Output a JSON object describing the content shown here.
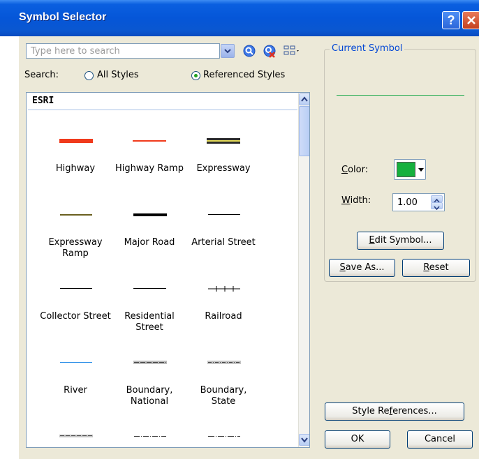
{
  "title": "Symbol Selector",
  "search": {
    "placeholder": "Type here to search",
    "label": "Search:",
    "option_all": "All Styles",
    "option_referenced": "Referenced Styles",
    "selected": "Referenced Styles"
  },
  "list": {
    "header": "ESRI",
    "symbols": [
      {
        "name": "Highway"
      },
      {
        "name": "Highway Ramp"
      },
      {
        "name": "Expressway"
      },
      {
        "name": "Expressway\nRamp"
      },
      {
        "name": "Major Road"
      },
      {
        "name": "Arterial Street"
      },
      {
        "name": "Collector Street"
      },
      {
        "name": "Residential\nStreet"
      },
      {
        "name": "Railroad"
      },
      {
        "name": "River"
      },
      {
        "name": "Boundary,\nNational"
      },
      {
        "name": "Boundary,\nState"
      }
    ]
  },
  "current_symbol": {
    "label": "Current Symbol",
    "preview_color": "#1aa84a",
    "color_label": "Color:",
    "color_value": "#16b03e",
    "width_label": "Width:",
    "width_value": "1.00"
  },
  "buttons": {
    "edit_symbol": "Edit Symbol...",
    "save_as": "Save As...",
    "reset": "Reset",
    "style_references": "Style References...",
    "ok": "OK",
    "cancel": "Cancel"
  }
}
